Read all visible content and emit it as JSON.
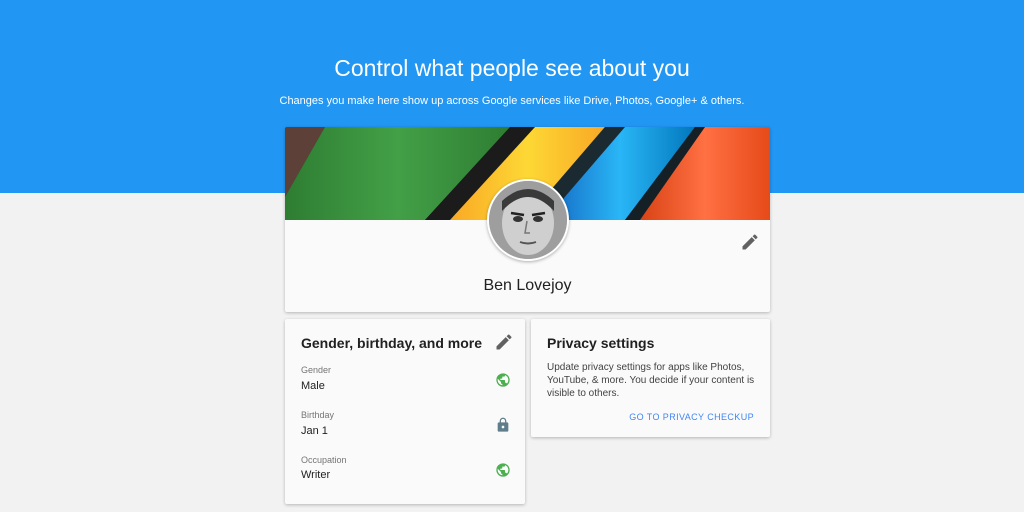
{
  "header": {
    "title": "Control what people see about you",
    "subtitle": "Changes you make here show up across Google services like Drive, Photos, Google+ & others."
  },
  "profile": {
    "name": "Ben Lovejoy",
    "edit_icon": "pencil-icon"
  },
  "about": {
    "title": "Gender, birthday, and more",
    "edit_icon": "pencil-icon",
    "fields": [
      {
        "label": "Gender",
        "value": "Male",
        "visibility_icon": "globe-icon"
      },
      {
        "label": "Birthday",
        "value": "Jan 1",
        "visibility_icon": "lock-icon"
      },
      {
        "label": "Occupation",
        "value": "Writer",
        "visibility_icon": "globe-icon"
      }
    ]
  },
  "privacy": {
    "title": "Privacy settings",
    "description": "Update privacy settings for apps like Photos, YouTube, & more. You decide if your content is visible to others.",
    "link_label": "GO TO PRIVACY CHECKUP"
  },
  "colors": {
    "hero": "#2196f3",
    "public_icon": "#4caf50",
    "private_icon": "#607d8b",
    "link": "#4285f4"
  }
}
